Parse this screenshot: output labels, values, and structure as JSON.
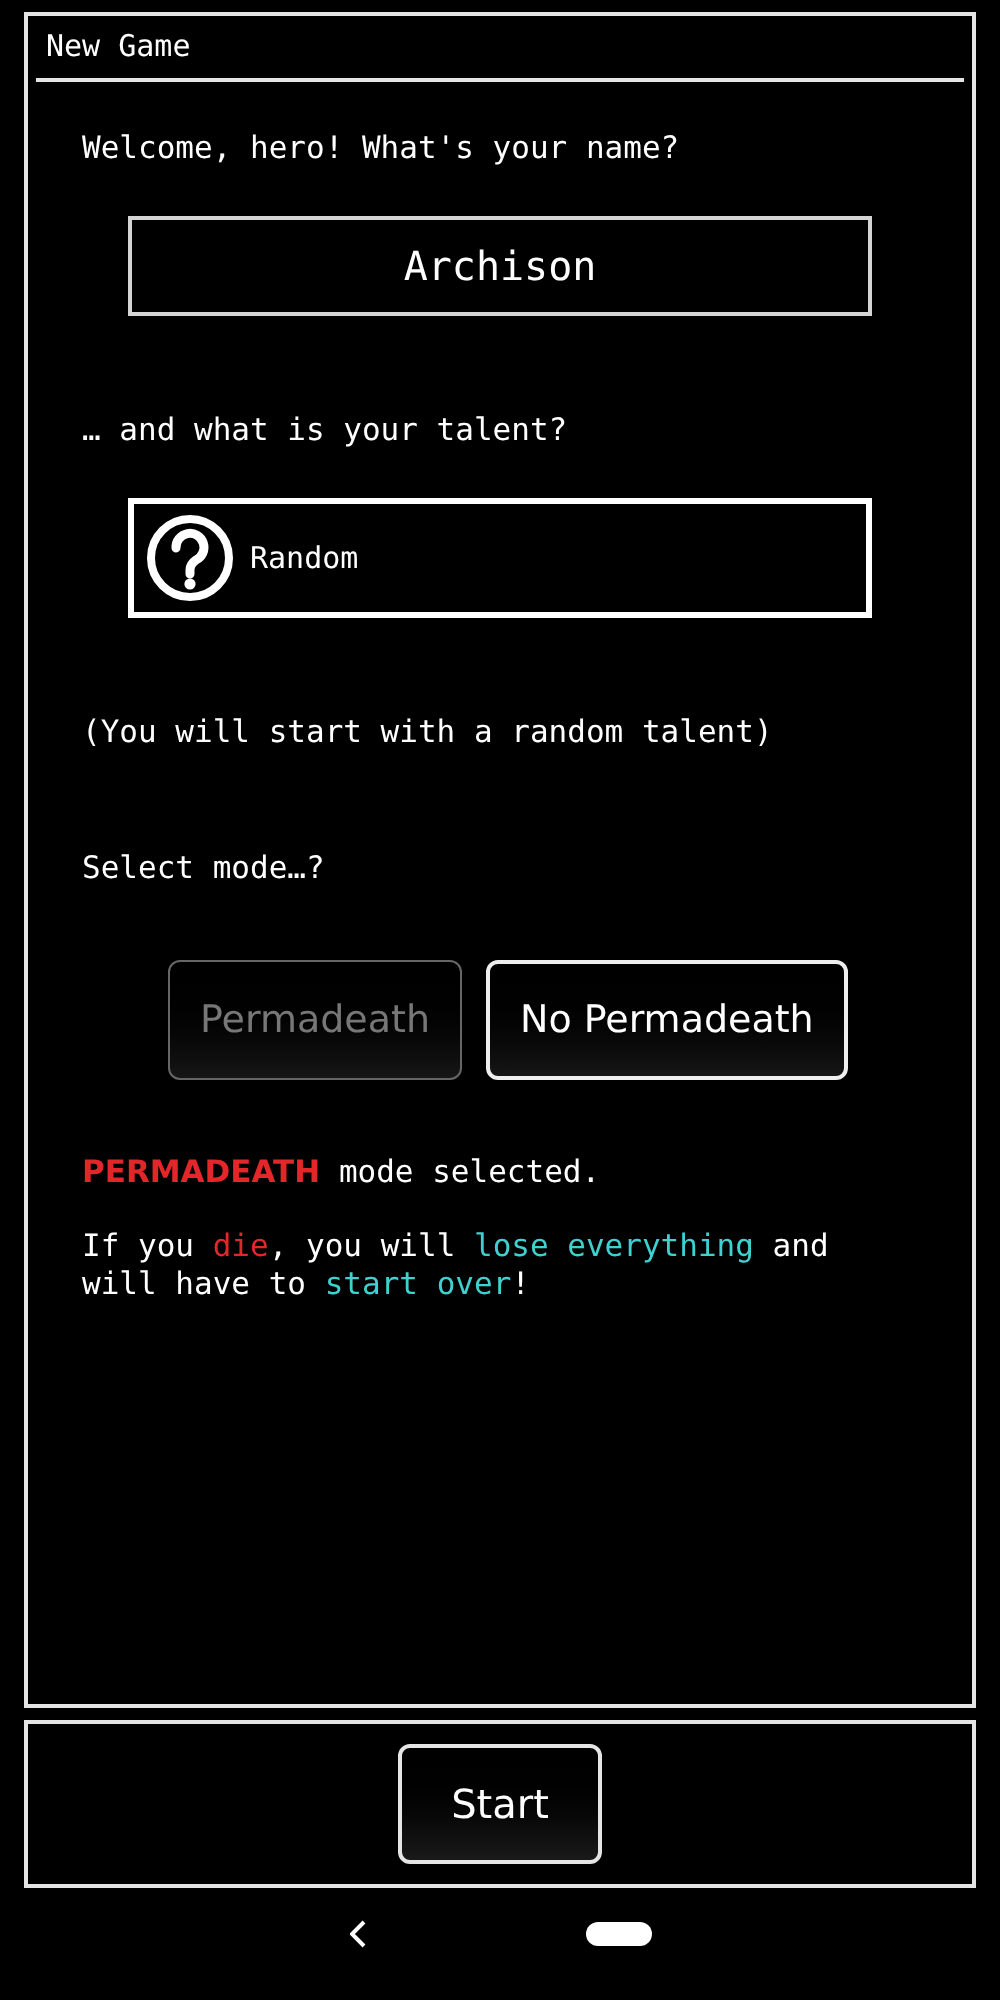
{
  "window": {
    "title": "New Game"
  },
  "name_prompt": "Welcome, hero! What's your name?",
  "name_field": {
    "value": "Archison"
  },
  "talent_prompt": "… and what is your talent?",
  "talent_button": {
    "label": "Random"
  },
  "talent_hint": "(You will start with a random talent)",
  "mode_prompt": "Select mode…?",
  "modes": [
    {
      "label": "Permadeath",
      "selected": true
    },
    {
      "label": "No Permadeath",
      "selected": false
    }
  ],
  "mode_status": [
    {
      "text": "PERMADEATH",
      "kind": "danger"
    },
    {
      "text": " mode selected.",
      "kind": "plain"
    }
  ],
  "warning": [
    {
      "text": "If you ",
      "kind": "plain"
    },
    {
      "text": "die",
      "kind": "danger"
    },
    {
      "text": ", you will ",
      "kind": "plain"
    },
    {
      "text": "lose everything",
      "kind": "highlight"
    },
    {
      "text": " and will have to ",
      "kind": "plain"
    },
    {
      "text": "start over",
      "kind": "highlight"
    },
    {
      "text": "!",
      "kind": "plain"
    }
  ],
  "start_button": {
    "label": "Start"
  }
}
